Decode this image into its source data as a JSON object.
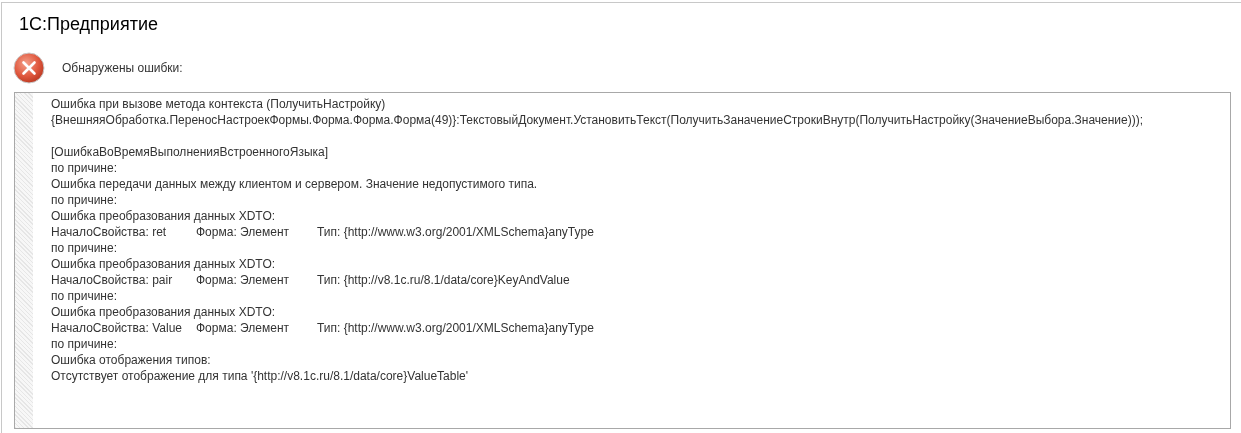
{
  "window": {
    "title": "1С:Предприятие"
  },
  "header": {
    "message": "Обнаружены ошибки:"
  },
  "details": [
    {
      "kind": "text",
      "text": "Ошибка при вызове метода контекста (ПолучитьНастройку)"
    },
    {
      "kind": "text",
      "text": "{ВнешняяОбработка.ПереносНастроекФормы.Форма.Форма.Форма(49)}:ТекстовыйДокумент.УстановитьТекст(ПолучитьЗаначениеСтрокиВнутр(ПолучитьНастройку(ЗначениеВыбора.Значение)));"
    },
    {
      "kind": "blank"
    },
    {
      "kind": "text",
      "text": "[ОшибкаВоВремяВыполненияВстроенногоЯзыка]"
    },
    {
      "kind": "text",
      "text": "по причине:"
    },
    {
      "kind": "text",
      "text": "Ошибка передачи данных между клиентом и сервером. Значение недопустимого типа."
    },
    {
      "kind": "text",
      "text": "по причине:"
    },
    {
      "kind": "text",
      "text": "Ошибка преобразования данных XDTO:"
    },
    {
      "kind": "fields",
      "parts": [
        "НачалоСвойства: ret",
        "Форма: Элемент",
        "Тип: {http://www.w3.org/2001/XMLSchema}anyType"
      ]
    },
    {
      "kind": "text",
      "text": "по причине:"
    },
    {
      "kind": "text",
      "text": "Ошибка преобразования данных XDTO:"
    },
    {
      "kind": "fields",
      "parts": [
        "НачалоСвойства: pair",
        "Форма: Элемент",
        "Тип: {http://v8.1c.ru/8.1/data/core}KeyAndValue"
      ]
    },
    {
      "kind": "text",
      "text": "по причине:"
    },
    {
      "kind": "text",
      "text": "Ошибка преобразования данных XDTO:"
    },
    {
      "kind": "fields",
      "parts": [
        "НачалоСвойства: Value",
        "Форма: Элемент",
        "Тип: {http://www.w3.org/2001/XMLSchema}anyType"
      ]
    },
    {
      "kind": "text",
      "text": "по причине:"
    },
    {
      "kind": "text",
      "text": "Ошибка отображения типов:"
    },
    {
      "kind": "text",
      "text": "Отсутствует отображение для типа '{http://v8.1c.ru/8.1/data/core}ValueTable'"
    }
  ]
}
